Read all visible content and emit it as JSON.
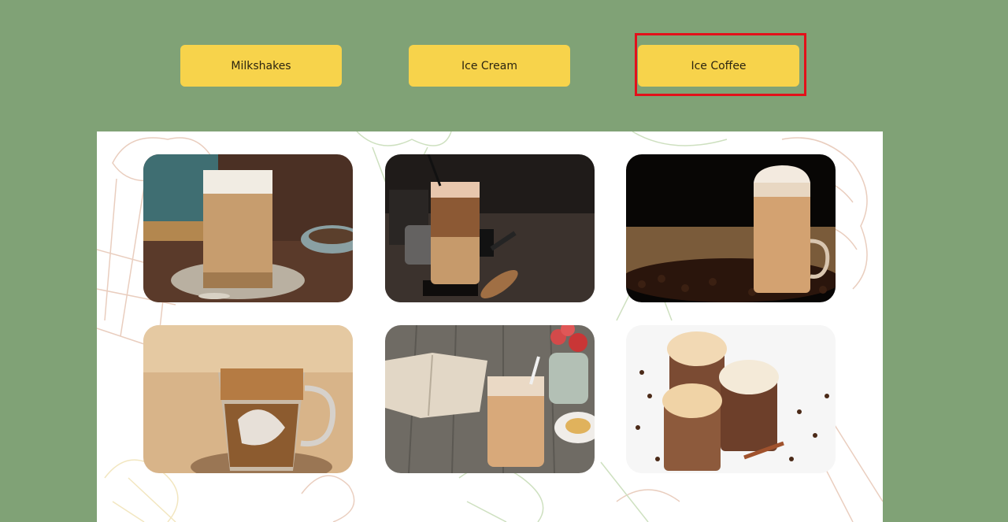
{
  "tabs": [
    {
      "label": "Milkshakes"
    },
    {
      "label": "Ice Cream"
    },
    {
      "label": "Ice Coffee"
    }
  ],
  "selected_tab": "Ice Coffee",
  "colors": {
    "background": "#80a276",
    "button": "#f7d34b",
    "highlight": "#e3101a",
    "panel": "#ffffff"
  },
  "gallery": [
    {
      "icon": "iced-latte-photo"
    },
    {
      "icon": "iced-coffee-dark-table-photo"
    },
    {
      "icon": "whipped-iced-coffee-beans-photo"
    },
    {
      "icon": "iced-coffee-mug-photo"
    },
    {
      "icon": "iced-coffee-book-flowers-photo"
    },
    {
      "icon": "mocha-frappes-photo"
    }
  ]
}
